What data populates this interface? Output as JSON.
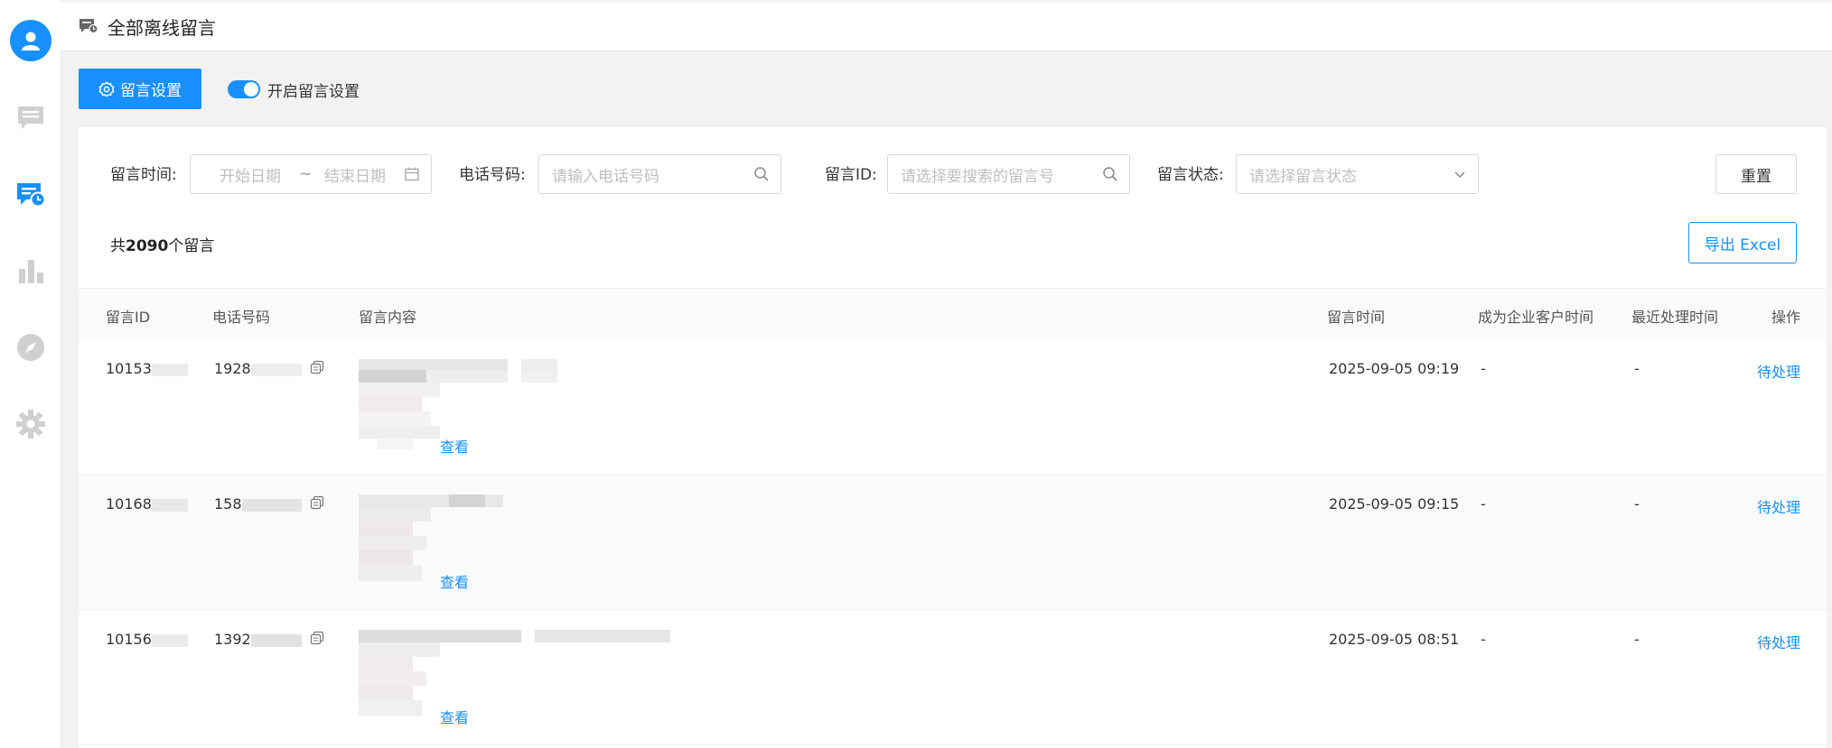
{
  "nav": {
    "items": [
      "avatar",
      "chat-icon",
      "offline-message-icon",
      "bar-chart-icon",
      "compass-icon",
      "gear-icon"
    ]
  },
  "header": {
    "title": "全部离线留言"
  },
  "toolbar": {
    "settings_label": "留言设置",
    "toggle_label": "开启留言设置",
    "toggle_on": true
  },
  "filters": {
    "time_label": "留言时间:",
    "start_placeholder": "开始日期",
    "range_sep": "~",
    "end_placeholder": "结束日期",
    "phone_label": "电话号码:",
    "phone_placeholder": "请输入电话号码",
    "id_label": "留言ID:",
    "id_placeholder": "请选择要搜索的留言号",
    "status_label": "留言状态:",
    "status_placeholder": "请选择留言状态",
    "reset_label": "重置"
  },
  "summary": {
    "prefix": "共",
    "count": "2090",
    "suffix": "个留言"
  },
  "export_label": "导出 Excel",
  "table": {
    "columns": [
      "留言ID",
      "电话号码",
      "留言内容",
      "留言时间",
      "成为企业客户时间",
      "最近处理时间",
      "操作"
    ],
    "rows": [
      {
        "id": "10153",
        "phone": "1928",
        "time": "2025-09-05 09:19",
        "customer_time": "-",
        "last_time": "-",
        "action": "待处理",
        "view": "查看"
      },
      {
        "id": "10168",
        "phone": "158",
        "time": "2025-09-05 09:15",
        "customer_time": "-",
        "last_time": "-",
        "action": "待处理",
        "view": "查看"
      },
      {
        "id": "10156",
        "phone": "1392",
        "time": "2025-09-05 08:51",
        "customer_time": "-",
        "last_time": "-",
        "action": "待处理",
        "view": "查看"
      }
    ]
  },
  "colors": {
    "primary": "#1890ff",
    "background": "#f2f2f2",
    "sidebar_icon": "#c8c8c8"
  }
}
